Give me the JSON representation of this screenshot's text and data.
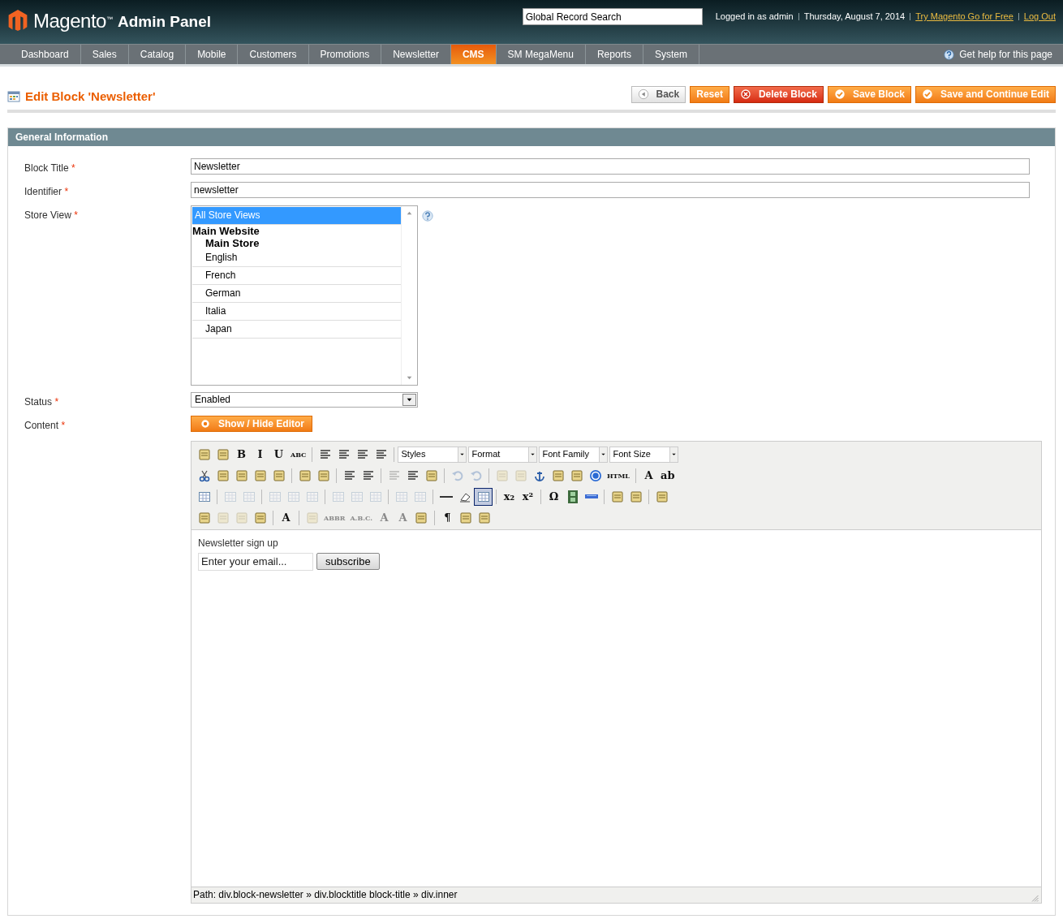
{
  "header": {
    "logo_text": "Magento",
    "logo_mark": "™",
    "logo_sub": "Admin Panel",
    "search": {
      "value": "Global Record Search"
    },
    "user": "Logged in as admin",
    "date": "Thursday, August 7, 2014",
    "links": [
      "Try Magento Go for Free",
      "Log Out"
    ]
  },
  "nav": {
    "items": [
      {
        "label": "Dashboard",
        "selected": false
      },
      {
        "label": "Sales",
        "selected": false
      },
      {
        "label": "Catalog",
        "selected": false
      },
      {
        "label": "Mobile",
        "selected": false
      },
      {
        "label": "Customers",
        "selected": false
      },
      {
        "label": "Promotions",
        "selected": false
      },
      {
        "label": "Newsletter",
        "selected": false
      },
      {
        "label": "CMS",
        "selected": true
      },
      {
        "label": "SM MegaMenu",
        "selected": false
      },
      {
        "label": "Reports",
        "selected": false
      },
      {
        "label": "System",
        "selected": false
      }
    ],
    "help": "Get help for this page"
  },
  "page_title": "Edit Block 'Newsletter'",
  "buttons": [
    {
      "label": "Back",
      "kind": "back"
    },
    {
      "label": "Reset",
      "kind": "plain"
    },
    {
      "label": "Delete Block",
      "kind": "delete"
    },
    {
      "label": "Save Block",
      "kind": "save"
    },
    {
      "label": "Save and Continue Edit",
      "kind": "save"
    }
  ],
  "section_title": "General Information",
  "required_mark": "*",
  "fields": [
    {
      "kind": "text",
      "label": "Block Title",
      "required": true,
      "value": "Newsletter"
    },
    {
      "kind": "text",
      "label": "Identifier",
      "required": true,
      "value": "newsletter"
    },
    {
      "kind": "multiselect",
      "label": "Store View",
      "required": true,
      "options": [
        {
          "kind": "option",
          "label": "All Store Views",
          "selected": true
        },
        {
          "kind": "group",
          "label": "Main Website",
          "children": [
            {
              "kind": "group",
              "label": "Main Store",
              "children": [
                {
                  "kind": "option",
                  "label": "English",
                  "selected": false
                },
                {
                  "kind": "option",
                  "label": "French",
                  "selected": false
                },
                {
                  "kind": "option",
                  "label": "German",
                  "selected": false
                },
                {
                  "kind": "option",
                  "label": "Italia",
                  "selected": false
                },
                {
                  "kind": "option",
                  "label": "Japan",
                  "selected": false
                }
              ]
            }
          ]
        }
      ]
    },
    {
      "kind": "select",
      "label": "Status",
      "required": true,
      "value": "Enabled"
    },
    {
      "kind": "editor",
      "label": "Content",
      "required": true,
      "toggle": "Show / Hide Editor"
    }
  ],
  "editor": {
    "toolbar": [
      [
        {
          "kind": "icon",
          "disabled": false,
          "active": false
        },
        {
          "kind": "icon",
          "disabled": false,
          "active": false
        },
        {
          "kind": "glyph",
          "text": "B",
          "disabled": false,
          "active": false
        },
        {
          "kind": "glyph",
          "text": "I",
          "disabled": false,
          "active": false
        },
        {
          "kind": "glyph",
          "text": "U",
          "disabled": false,
          "active": false
        },
        {
          "kind": "glyph",
          "text": "ABC",
          "disabled": false,
          "active": false
        },
        {
          "kind": "sep"
        },
        {
          "kind": "icon",
          "disabled": false,
          "active": false
        },
        {
          "kind": "icon",
          "disabled": false,
          "active": false
        },
        {
          "kind": "icon",
          "disabled": false,
          "active": false
        },
        {
          "kind": "icon",
          "disabled": false,
          "active": false
        },
        {
          "kind": "sep"
        },
        {
          "kind": "select",
          "label": "Styles"
        },
        {
          "kind": "select",
          "label": "Format"
        },
        {
          "kind": "select",
          "label": "Font Family"
        },
        {
          "kind": "select",
          "label": "Font Size"
        }
      ],
      [
        {
          "kind": "icon",
          "disabled": false,
          "active": false
        },
        {
          "kind": "icon",
          "disabled": false,
          "active": false
        },
        {
          "kind": "icon",
          "disabled": false,
          "active": false
        },
        {
          "kind": "icon",
          "disabled": false,
          "active": false
        },
        {
          "kind": "icon",
          "disabled": false,
          "active": false
        },
        {
          "kind": "sep"
        },
        {
          "kind": "icon",
          "disabled": false,
          "active": false
        },
        {
          "kind": "icon",
          "disabled": false,
          "active": false
        },
        {
          "kind": "sep"
        },
        {
          "kind": "icon",
          "disabled": false,
          "active": false
        },
        {
          "kind": "icon",
          "disabled": false,
          "active": false
        },
        {
          "kind": "sep"
        },
        {
          "kind": "icon",
          "disabled": true,
          "active": false
        },
        {
          "kind": "icon",
          "disabled": false,
          "active": false
        },
        {
          "kind": "icon",
          "disabled": false,
          "active": false
        },
        {
          "kind": "sep"
        },
        {
          "kind": "icon",
          "disabled": true,
          "active": false
        },
        {
          "kind": "icon",
          "disabled": true,
          "active": false
        },
        {
          "kind": "sep"
        },
        {
          "kind": "icon",
          "disabled": true,
          "active": false
        },
        {
          "kind": "icon",
          "disabled": true,
          "active": false
        },
        {
          "kind": "icon",
          "disabled": false,
          "active": false
        },
        {
          "kind": "icon",
          "disabled": false,
          "active": false
        },
        {
          "kind": "icon",
          "disabled": false,
          "active": false
        },
        {
          "kind": "icon",
          "disabled": false,
          "active": false
        },
        {
          "kind": "glyph",
          "text": "HTML",
          "disabled": false,
          "active": false
        },
        {
          "kind": "sep"
        },
        {
          "kind": "glyph",
          "text": "A",
          "disabled": false,
          "active": false
        },
        {
          "kind": "glyph",
          "text": "ab",
          "disabled": false,
          "active": false
        }
      ],
      [
        {
          "kind": "icon",
          "disabled": false,
          "active": false
        },
        {
          "kind": "sep"
        },
        {
          "kind": "icon",
          "disabled": true,
          "active": false
        },
        {
          "kind": "icon",
          "disabled": true,
          "active": false
        },
        {
          "kind": "sep"
        },
        {
          "kind": "icon",
          "disabled": true,
          "active": false
        },
        {
          "kind": "icon",
          "disabled": true,
          "active": false
        },
        {
          "kind": "icon",
          "disabled": true,
          "active": false
        },
        {
          "kind": "sep"
        },
        {
          "kind": "icon",
          "disabled": true,
          "active": false
        },
        {
          "kind": "icon",
          "disabled": true,
          "active": false
        },
        {
          "kind": "icon",
          "disabled": true,
          "active": false
        },
        {
          "kind": "sep"
        },
        {
          "kind": "icon",
          "disabled": true,
          "active": false
        },
        {
          "kind": "icon",
          "disabled": true,
          "active": false
        },
        {
          "kind": "sep"
        },
        {
          "kind": "icon",
          "disabled": false,
          "active": false
        },
        {
          "kind": "icon",
          "disabled": false,
          "active": false
        },
        {
          "kind": "icon",
          "disabled": false,
          "active": true
        },
        {
          "kind": "sep"
        },
        {
          "kind": "glyph",
          "text": "x₂",
          "disabled": false,
          "active": false
        },
        {
          "kind": "glyph",
          "text": "x²",
          "disabled": false,
          "active": false
        },
        {
          "kind": "sep"
        },
        {
          "kind": "glyph",
          "text": "Ω",
          "disabled": false,
          "active": false
        },
        {
          "kind": "icon",
          "disabled": false,
          "active": false
        },
        {
          "kind": "icon",
          "disabled": false,
          "active": false
        },
        {
          "kind": "sep"
        },
        {
          "kind": "icon",
          "disabled": false,
          "active": false
        },
        {
          "kind": "icon",
          "disabled": false,
          "active": false
        },
        {
          "kind": "sep"
        },
        {
          "kind": "icon",
          "disabled": false,
          "active": false
        }
      ],
      [
        {
          "kind": "icon",
          "disabled": false,
          "active": false
        },
        {
          "kind": "icon",
          "disabled": true,
          "active": false
        },
        {
          "kind": "icon",
          "disabled": true,
          "active": false
        },
        {
          "kind": "icon",
          "disabled": false,
          "active": false
        },
        {
          "kind": "sep"
        },
        {
          "kind": "glyph",
          "text": "A",
          "disabled": false,
          "active": false
        },
        {
          "kind": "sep"
        },
        {
          "kind": "icon",
          "disabled": true,
          "active": false
        },
        {
          "kind": "glyph",
          "text": "ABBR",
          "disabled": true,
          "active": false
        },
        {
          "kind": "glyph",
          "text": "A.B.C.",
          "disabled": true,
          "active": false
        },
        {
          "kind": "glyph",
          "text": "A",
          "disabled": true,
          "active": false
        },
        {
          "kind": "glyph",
          "text": "A",
          "disabled": true,
          "active": false
        },
        {
          "kind": "icon",
          "disabled": false,
          "active": false
        },
        {
          "kind": "sep"
        },
        {
          "kind": "glyph",
          "text": "¶",
          "disabled": false,
          "active": false
        },
        {
          "kind": "icon",
          "disabled": false,
          "active": false
        },
        {
          "kind": "icon",
          "disabled": false,
          "active": false
        }
      ]
    ],
    "content": {
      "heading": "Newsletter sign up",
      "email": {
        "placeholder": "Enter your email..."
      },
      "button": "subscribe"
    },
    "path": "Path: div.block-newsletter » div.blocktitle block-title » div.inner"
  }
}
